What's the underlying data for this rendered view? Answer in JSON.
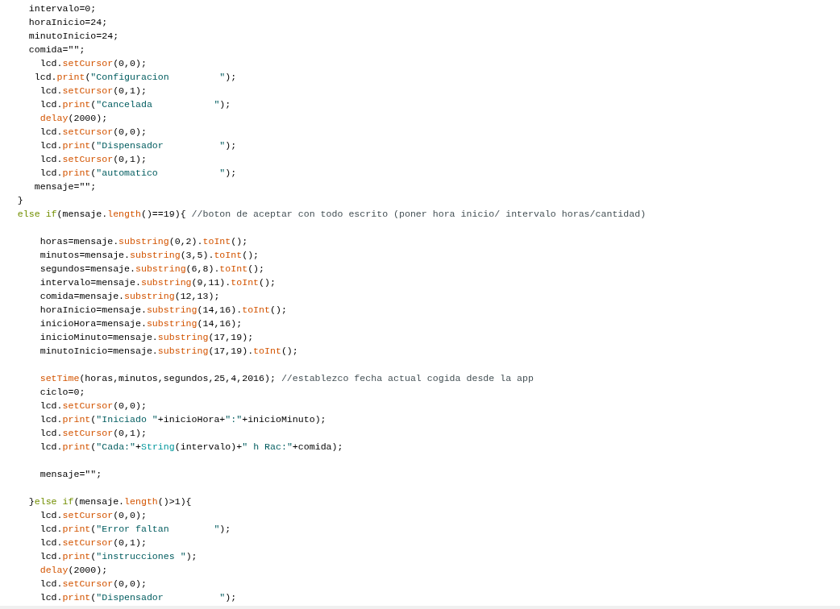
{
  "code_lines": [
    {
      "kind": "code",
      "tokens": [
        {
          "kind": "plain",
          "text": "     intervalo=0;"
        }
      ]
    },
    {
      "kind": "code",
      "tokens": [
        {
          "kind": "plain",
          "text": "     horaInicio=24;"
        }
      ]
    },
    {
      "kind": "code",
      "tokens": [
        {
          "kind": "plain",
          "text": "     minutoInicio=24;"
        }
      ]
    },
    {
      "kind": "code",
      "tokens": [
        {
          "kind": "plain",
          "text": "     comida=\"\";"
        }
      ]
    },
    {
      "kind": "code",
      "tokens": [
        {
          "kind": "plain",
          "text": "       lcd."
        },
        {
          "kind": "function",
          "text": "setCursor"
        },
        {
          "kind": "plain",
          "text": "(0,0);"
        }
      ]
    },
    {
      "kind": "code",
      "tokens": [
        {
          "kind": "plain",
          "text": "      lcd."
        },
        {
          "kind": "function",
          "text": "print"
        },
        {
          "kind": "plain",
          "text": "("
        },
        {
          "kind": "string",
          "text": "\"Configuracion         \""
        },
        {
          "kind": "plain",
          "text": ");"
        }
      ]
    },
    {
      "kind": "code",
      "tokens": [
        {
          "kind": "plain",
          "text": "       lcd."
        },
        {
          "kind": "function",
          "text": "setCursor"
        },
        {
          "kind": "plain",
          "text": "(0,1);"
        }
      ]
    },
    {
      "kind": "code",
      "tokens": [
        {
          "kind": "plain",
          "text": "       lcd."
        },
        {
          "kind": "function",
          "text": "print"
        },
        {
          "kind": "plain",
          "text": "("
        },
        {
          "kind": "string",
          "text": "\"Cancelada           \""
        },
        {
          "kind": "plain",
          "text": ");"
        }
      ]
    },
    {
      "kind": "code",
      "tokens": [
        {
          "kind": "function",
          "text": "       delay"
        },
        {
          "kind": "plain",
          "text": "(2000);"
        }
      ]
    },
    {
      "kind": "code",
      "tokens": [
        {
          "kind": "plain",
          "text": "       lcd."
        },
        {
          "kind": "function",
          "text": "setCursor"
        },
        {
          "kind": "plain",
          "text": "(0,0);"
        }
      ]
    },
    {
      "kind": "code",
      "tokens": [
        {
          "kind": "plain",
          "text": "       lcd."
        },
        {
          "kind": "function",
          "text": "print"
        },
        {
          "kind": "plain",
          "text": "("
        },
        {
          "kind": "string",
          "text": "\"Dispensador          \""
        },
        {
          "kind": "plain",
          "text": ");"
        }
      ]
    },
    {
      "kind": "code",
      "tokens": [
        {
          "kind": "plain",
          "text": "       lcd."
        },
        {
          "kind": "function",
          "text": "setCursor"
        },
        {
          "kind": "plain",
          "text": "(0,1);"
        }
      ]
    },
    {
      "kind": "code",
      "tokens": [
        {
          "kind": "plain",
          "text": "       lcd."
        },
        {
          "kind": "function",
          "text": "print"
        },
        {
          "kind": "plain",
          "text": "("
        },
        {
          "kind": "string",
          "text": "\"automatico           \""
        },
        {
          "kind": "plain",
          "text": ");"
        }
      ]
    },
    {
      "kind": "code",
      "tokens": [
        {
          "kind": "plain",
          "text": "      mensaje=\"\";"
        }
      ]
    },
    {
      "kind": "code",
      "tokens": [
        {
          "kind": "plain",
          "text": "   }"
        }
      ]
    },
    {
      "kind": "code",
      "tokens": [
        {
          "kind": "keyword",
          "text": "   else if"
        },
        {
          "kind": "plain",
          "text": "(mensaje."
        },
        {
          "kind": "function",
          "text": "length"
        },
        {
          "kind": "plain",
          "text": "()==19){ "
        },
        {
          "kind": "comment",
          "text": "//boton de aceptar con todo escrito (poner hora inicio/ intervalo horas/cantidad)"
        }
      ]
    },
    {
      "kind": "blank"
    },
    {
      "kind": "code",
      "tokens": [
        {
          "kind": "plain",
          "text": "       horas=mensaje."
        },
        {
          "kind": "function",
          "text": "substring"
        },
        {
          "kind": "plain",
          "text": "(0,2)."
        },
        {
          "kind": "function",
          "text": "toInt"
        },
        {
          "kind": "plain",
          "text": "();"
        }
      ]
    },
    {
      "kind": "code",
      "tokens": [
        {
          "kind": "plain",
          "text": "       minutos=mensaje."
        },
        {
          "kind": "function",
          "text": "substring"
        },
        {
          "kind": "plain",
          "text": "(3,5)."
        },
        {
          "kind": "function",
          "text": "toInt"
        },
        {
          "kind": "plain",
          "text": "();"
        }
      ]
    },
    {
      "kind": "code",
      "tokens": [
        {
          "kind": "plain",
          "text": "       segundos=mensaje."
        },
        {
          "kind": "function",
          "text": "substring"
        },
        {
          "kind": "plain",
          "text": "(6,8)."
        },
        {
          "kind": "function",
          "text": "toInt"
        },
        {
          "kind": "plain",
          "text": "();"
        }
      ]
    },
    {
      "kind": "code",
      "tokens": [
        {
          "kind": "plain",
          "text": "       intervalo=mensaje."
        },
        {
          "kind": "function",
          "text": "substring"
        },
        {
          "kind": "plain",
          "text": "(9,11)."
        },
        {
          "kind": "function",
          "text": "toInt"
        },
        {
          "kind": "plain",
          "text": "();"
        }
      ]
    },
    {
      "kind": "code",
      "tokens": [
        {
          "kind": "plain",
          "text": "       comida=mensaje."
        },
        {
          "kind": "function",
          "text": "substring"
        },
        {
          "kind": "plain",
          "text": "(12,13);"
        }
      ]
    },
    {
      "kind": "code",
      "tokens": [
        {
          "kind": "plain",
          "text": "       horaInicio=mensaje."
        },
        {
          "kind": "function",
          "text": "substring"
        },
        {
          "kind": "plain",
          "text": "(14,16)."
        },
        {
          "kind": "function",
          "text": "toInt"
        },
        {
          "kind": "plain",
          "text": "();"
        }
      ]
    },
    {
      "kind": "code",
      "tokens": [
        {
          "kind": "plain",
          "text": "       inicioHora=mensaje."
        },
        {
          "kind": "function",
          "text": "substring"
        },
        {
          "kind": "plain",
          "text": "(14,16);"
        }
      ]
    },
    {
      "kind": "code",
      "tokens": [
        {
          "kind": "plain",
          "text": "       inicioMinuto=mensaje."
        },
        {
          "kind": "function",
          "text": "substring"
        },
        {
          "kind": "plain",
          "text": "(17,19);"
        }
      ]
    },
    {
      "kind": "code",
      "tokens": [
        {
          "kind": "plain",
          "text": "       minutoInicio=mensaje."
        },
        {
          "kind": "function",
          "text": "substring"
        },
        {
          "kind": "plain",
          "text": "(17,19)."
        },
        {
          "kind": "function",
          "text": "toInt"
        },
        {
          "kind": "plain",
          "text": "();"
        }
      ]
    },
    {
      "kind": "blank"
    },
    {
      "kind": "code",
      "tokens": [
        {
          "kind": "function",
          "text": "       setTime"
        },
        {
          "kind": "plain",
          "text": "(horas,minutos,segundos,25,4,2016); "
        },
        {
          "kind": "comment",
          "text": "//establezco fecha actual cogida desde la app"
        }
      ]
    },
    {
      "kind": "code",
      "tokens": [
        {
          "kind": "plain",
          "text": "       ciclo=0;"
        }
      ]
    },
    {
      "kind": "code",
      "tokens": [
        {
          "kind": "plain",
          "text": "       lcd."
        },
        {
          "kind": "function",
          "text": "setCursor"
        },
        {
          "kind": "plain",
          "text": "(0,0);"
        }
      ]
    },
    {
      "kind": "code",
      "tokens": [
        {
          "kind": "plain",
          "text": "       lcd."
        },
        {
          "kind": "function",
          "text": "print"
        },
        {
          "kind": "plain",
          "text": "("
        },
        {
          "kind": "string",
          "text": "\"Iniciado \""
        },
        {
          "kind": "plain",
          "text": "+inicioHora+"
        },
        {
          "kind": "string",
          "text": "\":\""
        },
        {
          "kind": "plain",
          "text": "+inicioMinuto);"
        }
      ]
    },
    {
      "kind": "code",
      "tokens": [
        {
          "kind": "plain",
          "text": "       lcd."
        },
        {
          "kind": "function",
          "text": "setCursor"
        },
        {
          "kind": "plain",
          "text": "(0,1);"
        }
      ]
    },
    {
      "kind": "code",
      "tokens": [
        {
          "kind": "plain",
          "text": "       lcd."
        },
        {
          "kind": "function",
          "text": "print"
        },
        {
          "kind": "plain",
          "text": "("
        },
        {
          "kind": "string",
          "text": "\"Cada:\""
        },
        {
          "kind": "plain",
          "text": "+"
        },
        {
          "kind": "type",
          "text": "String"
        },
        {
          "kind": "plain",
          "text": "(intervalo)+"
        },
        {
          "kind": "string",
          "text": "\" h Rac:\""
        },
        {
          "kind": "plain",
          "text": "+comida);"
        }
      ]
    },
    {
      "kind": "blank"
    },
    {
      "kind": "code",
      "tokens": [
        {
          "kind": "plain",
          "text": "       mensaje=\"\";"
        }
      ]
    },
    {
      "kind": "blank"
    },
    {
      "kind": "code",
      "tokens": [
        {
          "kind": "plain",
          "text": "     }"
        },
        {
          "kind": "keyword",
          "text": "else if"
        },
        {
          "kind": "plain",
          "text": "(mensaje."
        },
        {
          "kind": "function",
          "text": "length"
        },
        {
          "kind": "plain",
          "text": "()>1){"
        }
      ]
    },
    {
      "kind": "code",
      "tokens": [
        {
          "kind": "plain",
          "text": "       lcd."
        },
        {
          "kind": "function",
          "text": "setCursor"
        },
        {
          "kind": "plain",
          "text": "(0,0);"
        }
      ]
    },
    {
      "kind": "code",
      "tokens": [
        {
          "kind": "plain",
          "text": "       lcd."
        },
        {
          "kind": "function",
          "text": "print"
        },
        {
          "kind": "plain",
          "text": "("
        },
        {
          "kind": "string",
          "text": "\"Error faltan        \""
        },
        {
          "kind": "plain",
          "text": ");"
        }
      ]
    },
    {
      "kind": "code",
      "tokens": [
        {
          "kind": "plain",
          "text": "       lcd."
        },
        {
          "kind": "function",
          "text": "setCursor"
        },
        {
          "kind": "plain",
          "text": "(0,1);"
        }
      ]
    },
    {
      "kind": "code",
      "tokens": [
        {
          "kind": "plain",
          "text": "       lcd."
        },
        {
          "kind": "function",
          "text": "print"
        },
        {
          "kind": "plain",
          "text": "("
        },
        {
          "kind": "string",
          "text": "\"instrucciones \""
        },
        {
          "kind": "plain",
          "text": ");"
        }
      ]
    },
    {
      "kind": "code",
      "tokens": [
        {
          "kind": "function",
          "text": "       delay"
        },
        {
          "kind": "plain",
          "text": "(2000);"
        }
      ]
    },
    {
      "kind": "code",
      "tokens": [
        {
          "kind": "plain",
          "text": "       lcd."
        },
        {
          "kind": "function",
          "text": "setCursor"
        },
        {
          "kind": "plain",
          "text": "(0,0);"
        }
      ]
    },
    {
      "kind": "code",
      "tokens": [
        {
          "kind": "plain",
          "text": "       lcd."
        },
        {
          "kind": "function",
          "text": "print"
        },
        {
          "kind": "plain",
          "text": "("
        },
        {
          "kind": "string",
          "text": "\"Dispensador          \""
        },
        {
          "kind": "plain",
          "text": ");"
        }
      ]
    }
  ]
}
